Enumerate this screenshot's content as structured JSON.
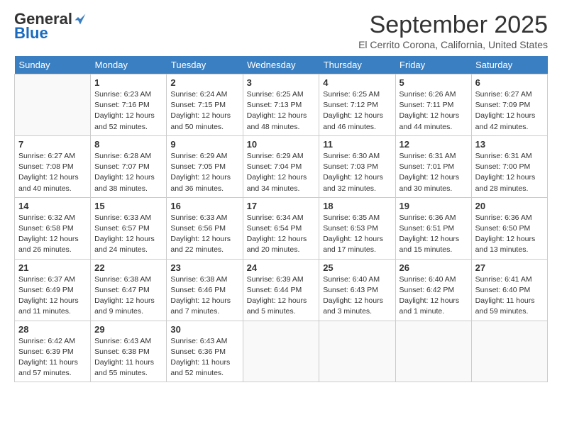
{
  "logo": {
    "general": "General",
    "blue": "Blue"
  },
  "title": "September 2025",
  "location": "El Cerrito Corona, California, United States",
  "days_of_week": [
    "Sunday",
    "Monday",
    "Tuesday",
    "Wednesday",
    "Thursday",
    "Friday",
    "Saturday"
  ],
  "weeks": [
    [
      {
        "day": "",
        "info": ""
      },
      {
        "day": "1",
        "info": "Sunrise: 6:23 AM\nSunset: 7:16 PM\nDaylight: 12 hours and 52 minutes."
      },
      {
        "day": "2",
        "info": "Sunrise: 6:24 AM\nSunset: 7:15 PM\nDaylight: 12 hours and 50 minutes."
      },
      {
        "day": "3",
        "info": "Sunrise: 6:25 AM\nSunset: 7:13 PM\nDaylight: 12 hours and 48 minutes."
      },
      {
        "day": "4",
        "info": "Sunrise: 6:25 AM\nSunset: 7:12 PM\nDaylight: 12 hours and 46 minutes."
      },
      {
        "day": "5",
        "info": "Sunrise: 6:26 AM\nSunset: 7:11 PM\nDaylight: 12 hours and 44 minutes."
      },
      {
        "day": "6",
        "info": "Sunrise: 6:27 AM\nSunset: 7:09 PM\nDaylight: 12 hours and 42 minutes."
      }
    ],
    [
      {
        "day": "7",
        "info": "Sunrise: 6:27 AM\nSunset: 7:08 PM\nDaylight: 12 hours and 40 minutes."
      },
      {
        "day": "8",
        "info": "Sunrise: 6:28 AM\nSunset: 7:07 PM\nDaylight: 12 hours and 38 minutes."
      },
      {
        "day": "9",
        "info": "Sunrise: 6:29 AM\nSunset: 7:05 PM\nDaylight: 12 hours and 36 minutes."
      },
      {
        "day": "10",
        "info": "Sunrise: 6:29 AM\nSunset: 7:04 PM\nDaylight: 12 hours and 34 minutes."
      },
      {
        "day": "11",
        "info": "Sunrise: 6:30 AM\nSunset: 7:03 PM\nDaylight: 12 hours and 32 minutes."
      },
      {
        "day": "12",
        "info": "Sunrise: 6:31 AM\nSunset: 7:01 PM\nDaylight: 12 hours and 30 minutes."
      },
      {
        "day": "13",
        "info": "Sunrise: 6:31 AM\nSunset: 7:00 PM\nDaylight: 12 hours and 28 minutes."
      }
    ],
    [
      {
        "day": "14",
        "info": "Sunrise: 6:32 AM\nSunset: 6:58 PM\nDaylight: 12 hours and 26 minutes."
      },
      {
        "day": "15",
        "info": "Sunrise: 6:33 AM\nSunset: 6:57 PM\nDaylight: 12 hours and 24 minutes."
      },
      {
        "day": "16",
        "info": "Sunrise: 6:33 AM\nSunset: 6:56 PM\nDaylight: 12 hours and 22 minutes."
      },
      {
        "day": "17",
        "info": "Sunrise: 6:34 AM\nSunset: 6:54 PM\nDaylight: 12 hours and 20 minutes."
      },
      {
        "day": "18",
        "info": "Sunrise: 6:35 AM\nSunset: 6:53 PM\nDaylight: 12 hours and 17 minutes."
      },
      {
        "day": "19",
        "info": "Sunrise: 6:36 AM\nSunset: 6:51 PM\nDaylight: 12 hours and 15 minutes."
      },
      {
        "day": "20",
        "info": "Sunrise: 6:36 AM\nSunset: 6:50 PM\nDaylight: 12 hours and 13 minutes."
      }
    ],
    [
      {
        "day": "21",
        "info": "Sunrise: 6:37 AM\nSunset: 6:49 PM\nDaylight: 12 hours and 11 minutes."
      },
      {
        "day": "22",
        "info": "Sunrise: 6:38 AM\nSunset: 6:47 PM\nDaylight: 12 hours and 9 minutes."
      },
      {
        "day": "23",
        "info": "Sunrise: 6:38 AM\nSunset: 6:46 PM\nDaylight: 12 hours and 7 minutes."
      },
      {
        "day": "24",
        "info": "Sunrise: 6:39 AM\nSunset: 6:44 PM\nDaylight: 12 hours and 5 minutes."
      },
      {
        "day": "25",
        "info": "Sunrise: 6:40 AM\nSunset: 6:43 PM\nDaylight: 12 hours and 3 minutes."
      },
      {
        "day": "26",
        "info": "Sunrise: 6:40 AM\nSunset: 6:42 PM\nDaylight: 12 hours and 1 minute."
      },
      {
        "day": "27",
        "info": "Sunrise: 6:41 AM\nSunset: 6:40 PM\nDaylight: 11 hours and 59 minutes."
      }
    ],
    [
      {
        "day": "28",
        "info": "Sunrise: 6:42 AM\nSunset: 6:39 PM\nDaylight: 11 hours and 57 minutes."
      },
      {
        "day": "29",
        "info": "Sunrise: 6:43 AM\nSunset: 6:38 PM\nDaylight: 11 hours and 55 minutes."
      },
      {
        "day": "30",
        "info": "Sunrise: 6:43 AM\nSunset: 6:36 PM\nDaylight: 11 hours and 52 minutes."
      },
      {
        "day": "",
        "info": ""
      },
      {
        "day": "",
        "info": ""
      },
      {
        "day": "",
        "info": ""
      },
      {
        "day": "",
        "info": ""
      }
    ]
  ]
}
